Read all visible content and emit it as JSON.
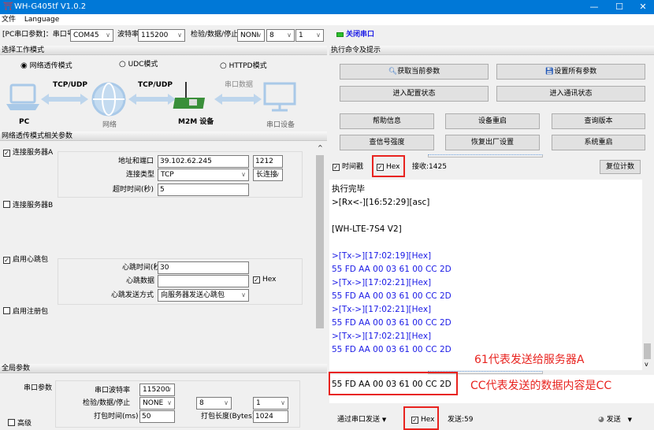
{
  "window": {
    "title": "WH-G405tf V1.0.2",
    "min": "—",
    "max": "☐",
    "close": "✕"
  },
  "menu": [
    "文件",
    "Language"
  ],
  "toolbar": {
    "label": "[PC串口参数]：串口号",
    "port": "COM45",
    "baud_label": "波特率",
    "baud": "115200",
    "parity_label": "检验/数据/停止",
    "parity": "NONI",
    "data_bits": "8",
    "stop_bits": "1",
    "close_port": "关闭串口",
    "status_color": "#2bc02b"
  },
  "mode": {
    "header": "选择工作模式",
    "options": [
      {
        "label": "网络透传模式",
        "selected": true
      },
      {
        "label": "UDC模式",
        "selected": false
      },
      {
        "label": "HTTPD模式",
        "selected": false
      }
    ],
    "diagram": {
      "pc": "PC",
      "net": "网络",
      "m2m": "M2M 设备",
      "serial": "串口设备",
      "link1": "TCP/UDP",
      "link2": "TCP/UDP",
      "link3": "串口数据"
    }
  },
  "params": {
    "header": "网络透传模式相关参数",
    "serverA": {
      "label": "连接服务器A",
      "checked": true,
      "addr_label": "地址和端口",
      "addr": "39.102.62.245",
      "port": "1212",
      "type_label": "连接类型",
      "type": "TCP",
      "conn": "长连接",
      "timeout_label": "超时时间(秒)",
      "timeout": "5"
    },
    "serverB": {
      "label": "连接服务器B",
      "checked": false
    },
    "heartbeat": {
      "label": "启用心跳包",
      "checked": true,
      "time_label": "心跳时间(秒)",
      "time": "30",
      "data_label": "心跳数据",
      "data": "",
      "hex_label": "Hex",
      "hex": true,
      "mode_label": "心跳发送方式",
      "mode": "向服务器发送心跳包"
    },
    "register": {
      "label": "启用注册包",
      "checked": false
    }
  },
  "global": {
    "header": "全局参数",
    "serial_label": "串口参数",
    "baud_label": "串口波特率",
    "baud": "115200",
    "parity_label": "检验/数据/停止",
    "parity": "NONE",
    "data_bits": "8",
    "stop_bits": "1",
    "pack_time_label": "打包时间(ms)",
    "pack_time": "50",
    "pack_len_label": "打包长度(Bytes)",
    "pack_len": "1024",
    "advanced": "高级"
  },
  "commands": {
    "header": "执行命令及提示",
    "get": "获取当前参数",
    "set": "设置所有参数",
    "enter_config": "进入配置状态",
    "enter_comm": "进入通讯状态",
    "help": "帮助信息",
    "restart_dev": "设备重启",
    "query_ver": "查询版本",
    "signal": "查信号强度",
    "factory": "恢复出厂设置",
    "sys_restart": "系统重启"
  },
  "recv": {
    "timestamp": "时间戳",
    "hex": "Hex",
    "count": "接收:1425",
    "reset": "复位计数"
  },
  "log": [
    {
      "t": "执行完毕",
      "c": "black"
    },
    {
      "t": ">[Rx<-][16:52:29][asc]",
      "c": "black"
    },
    {
      "t": "",
      "c": "black"
    },
    {
      "t": "[WH-LTE-7S4 V2]",
      "c": "black"
    },
    {
      "t": "",
      "c": "black"
    },
    {
      "t": ">[Tx->][17:02:19][Hex]",
      "c": "blue"
    },
    {
      "t": "55 FD AA 00 03 61 00 CC 2D",
      "c": "blue"
    },
    {
      "t": ">[Tx->][17:02:21][Hex]",
      "c": "blue"
    },
    {
      "t": "55 FD AA 00 03 61 00 CC 2D",
      "c": "blue"
    },
    {
      "t": ">[Tx->][17:02:21][Hex]",
      "c": "blue"
    },
    {
      "t": "55 FD AA 00 03 61 00 CC 2D",
      "c": "blue"
    },
    {
      "t": ">[Tx->][17:02:21][Hex]",
      "c": "blue"
    },
    {
      "t": "55 FD AA 00 03 61 00 CC 2D",
      "c": "blue"
    }
  ],
  "send": {
    "input": "55 FD AA 00 03 61 00 CC 2D",
    "via": "通过串口发送",
    "hex": "Hex",
    "count": "发送:59",
    "send": "发送"
  },
  "annotations": {
    "a1": "61代表发送给服务器A",
    "a2": "CC代表发送的数据内容是CC"
  }
}
